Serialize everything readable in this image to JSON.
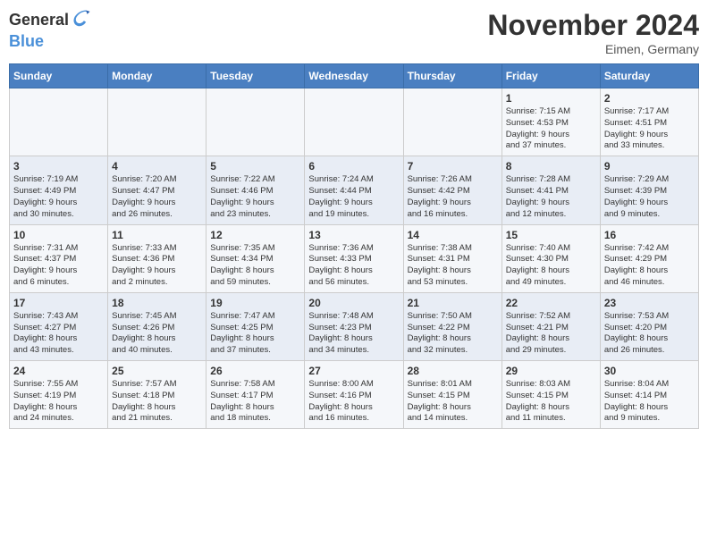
{
  "logo": {
    "general": "General",
    "blue": "Blue"
  },
  "header": {
    "month": "November 2024",
    "location": "Eimen, Germany"
  },
  "weekdays": [
    "Sunday",
    "Monday",
    "Tuesday",
    "Wednesday",
    "Thursday",
    "Friday",
    "Saturday"
  ],
  "weeks": [
    [
      {
        "day": "",
        "info": ""
      },
      {
        "day": "",
        "info": ""
      },
      {
        "day": "",
        "info": ""
      },
      {
        "day": "",
        "info": ""
      },
      {
        "day": "",
        "info": ""
      },
      {
        "day": "1",
        "info": "Sunrise: 7:15 AM\nSunset: 4:53 PM\nDaylight: 9 hours\nand 37 minutes."
      },
      {
        "day": "2",
        "info": "Sunrise: 7:17 AM\nSunset: 4:51 PM\nDaylight: 9 hours\nand 33 minutes."
      }
    ],
    [
      {
        "day": "3",
        "info": "Sunrise: 7:19 AM\nSunset: 4:49 PM\nDaylight: 9 hours\nand 30 minutes."
      },
      {
        "day": "4",
        "info": "Sunrise: 7:20 AM\nSunset: 4:47 PM\nDaylight: 9 hours\nand 26 minutes."
      },
      {
        "day": "5",
        "info": "Sunrise: 7:22 AM\nSunset: 4:46 PM\nDaylight: 9 hours\nand 23 minutes."
      },
      {
        "day": "6",
        "info": "Sunrise: 7:24 AM\nSunset: 4:44 PM\nDaylight: 9 hours\nand 19 minutes."
      },
      {
        "day": "7",
        "info": "Sunrise: 7:26 AM\nSunset: 4:42 PM\nDaylight: 9 hours\nand 16 minutes."
      },
      {
        "day": "8",
        "info": "Sunrise: 7:28 AM\nSunset: 4:41 PM\nDaylight: 9 hours\nand 12 minutes."
      },
      {
        "day": "9",
        "info": "Sunrise: 7:29 AM\nSunset: 4:39 PM\nDaylight: 9 hours\nand 9 minutes."
      }
    ],
    [
      {
        "day": "10",
        "info": "Sunrise: 7:31 AM\nSunset: 4:37 PM\nDaylight: 9 hours\nand 6 minutes."
      },
      {
        "day": "11",
        "info": "Sunrise: 7:33 AM\nSunset: 4:36 PM\nDaylight: 9 hours\nand 2 minutes."
      },
      {
        "day": "12",
        "info": "Sunrise: 7:35 AM\nSunset: 4:34 PM\nDaylight: 8 hours\nand 59 minutes."
      },
      {
        "day": "13",
        "info": "Sunrise: 7:36 AM\nSunset: 4:33 PM\nDaylight: 8 hours\nand 56 minutes."
      },
      {
        "day": "14",
        "info": "Sunrise: 7:38 AM\nSunset: 4:31 PM\nDaylight: 8 hours\nand 53 minutes."
      },
      {
        "day": "15",
        "info": "Sunrise: 7:40 AM\nSunset: 4:30 PM\nDaylight: 8 hours\nand 49 minutes."
      },
      {
        "day": "16",
        "info": "Sunrise: 7:42 AM\nSunset: 4:29 PM\nDaylight: 8 hours\nand 46 minutes."
      }
    ],
    [
      {
        "day": "17",
        "info": "Sunrise: 7:43 AM\nSunset: 4:27 PM\nDaylight: 8 hours\nand 43 minutes."
      },
      {
        "day": "18",
        "info": "Sunrise: 7:45 AM\nSunset: 4:26 PM\nDaylight: 8 hours\nand 40 minutes."
      },
      {
        "day": "19",
        "info": "Sunrise: 7:47 AM\nSunset: 4:25 PM\nDaylight: 8 hours\nand 37 minutes."
      },
      {
        "day": "20",
        "info": "Sunrise: 7:48 AM\nSunset: 4:23 PM\nDaylight: 8 hours\nand 34 minutes."
      },
      {
        "day": "21",
        "info": "Sunrise: 7:50 AM\nSunset: 4:22 PM\nDaylight: 8 hours\nand 32 minutes."
      },
      {
        "day": "22",
        "info": "Sunrise: 7:52 AM\nSunset: 4:21 PM\nDaylight: 8 hours\nand 29 minutes."
      },
      {
        "day": "23",
        "info": "Sunrise: 7:53 AM\nSunset: 4:20 PM\nDaylight: 8 hours\nand 26 minutes."
      }
    ],
    [
      {
        "day": "24",
        "info": "Sunrise: 7:55 AM\nSunset: 4:19 PM\nDaylight: 8 hours\nand 24 minutes."
      },
      {
        "day": "25",
        "info": "Sunrise: 7:57 AM\nSunset: 4:18 PM\nDaylight: 8 hours\nand 21 minutes."
      },
      {
        "day": "26",
        "info": "Sunrise: 7:58 AM\nSunset: 4:17 PM\nDaylight: 8 hours\nand 18 minutes."
      },
      {
        "day": "27",
        "info": "Sunrise: 8:00 AM\nSunset: 4:16 PM\nDaylight: 8 hours\nand 16 minutes."
      },
      {
        "day": "28",
        "info": "Sunrise: 8:01 AM\nSunset: 4:15 PM\nDaylight: 8 hours\nand 14 minutes."
      },
      {
        "day": "29",
        "info": "Sunrise: 8:03 AM\nSunset: 4:15 PM\nDaylight: 8 hours\nand 11 minutes."
      },
      {
        "day": "30",
        "info": "Sunrise: 8:04 AM\nSunset: 4:14 PM\nDaylight: 8 hours\nand 9 minutes."
      }
    ]
  ]
}
